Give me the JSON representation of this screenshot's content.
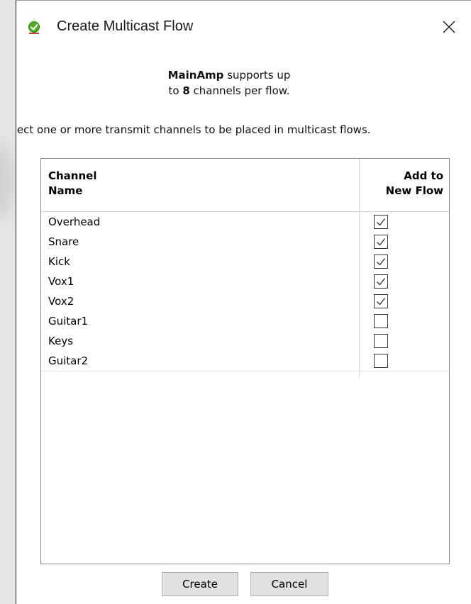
{
  "window": {
    "title": "Create Multicast Flow",
    "icon": "green-check-icon"
  },
  "info": {
    "device": "MainAmp",
    "supports_text": " supports up",
    "to_text": "to ",
    "channel_count": "8",
    "suffix": " channels per flow."
  },
  "instruction": "Select one or more transmit channels to be placed in multicast flows.",
  "table": {
    "headers": {
      "name_line1": "Channel",
      "name_line2": "Name",
      "flow_line1": "Add to",
      "flow_line2": "New Flow"
    },
    "rows": [
      {
        "name": "Overhead",
        "checked": true
      },
      {
        "name": "Snare",
        "checked": true
      },
      {
        "name": "Kick",
        "checked": true
      },
      {
        "name": "Vox1",
        "checked": true
      },
      {
        "name": "Vox2",
        "checked": true
      },
      {
        "name": "Guitar1",
        "checked": false
      },
      {
        "name": "Keys",
        "checked": false
      },
      {
        "name": "Guitar2",
        "checked": false
      }
    ]
  },
  "buttons": {
    "create": "Create",
    "cancel": "Cancel"
  },
  "colors": {
    "accent_green": "#4caf1e",
    "icon_red": "#d23a3a"
  }
}
